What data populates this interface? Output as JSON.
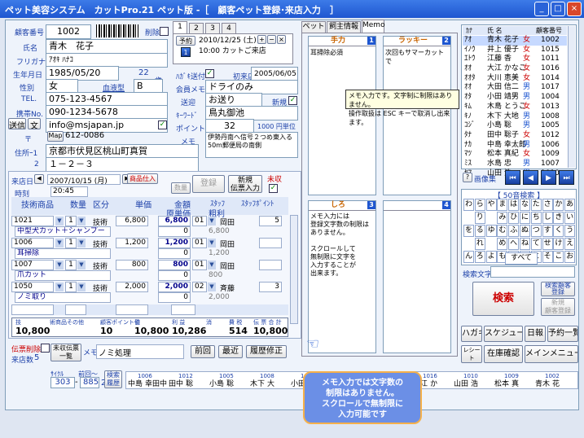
{
  "window": {
    "title": "ペット美容システム　カットPro.21 ペット版 -［　顧客ペット登録･来店入力　］",
    "min": "_",
    "max": "□",
    "close": "×"
  },
  "customer": {
    "no_label": "顧客番号",
    "no": "1002",
    "delete_label": "削除",
    "name_label": "氏名",
    "name": "青木　花子",
    "kana_label": "フリガナ",
    "kana": "ｱｵｷ ﾊﾅｺ",
    "birth_label": "生年月日",
    "birth": "1985/05/20",
    "age": "22",
    "age_unit": "歳",
    "sex_label": "性別",
    "sex": "女",
    "blood_label": "血液型",
    "blood": "B",
    "tel_label": "TEL.",
    "tel": "075-123-4567",
    "mobile_label": "携帯No.",
    "mobile": "090-1234-5678",
    "mail_send": "送信",
    "mail_text": "文",
    "mail": "info@msjapan.jp",
    "zip_label": "〒",
    "map_btn": "Map",
    "zip": "612-0086",
    "addr1_label": "住所ｰ1",
    "addr1": "京都市伏見区桃山町真賀",
    "addr2_label": "2",
    "addr2": "１－２－３"
  },
  "reserve": {
    "tabs": [
      "1",
      "2",
      "3",
      "4"
    ],
    "btn": "予約",
    "num": "1",
    "datetime": "2010/12/25 (土)",
    "text": "10:00 カットご来店"
  },
  "extra": {
    "hagaki_label": "ﾊｶﾞｷ送付",
    "first_label": "初来店",
    "first": "2005/06/05",
    "memo_label": "会員メモ",
    "memo": "ドライのみ",
    "send_label": "送迎",
    "send": "お送り",
    "new_label": "新規",
    "kw_label": "ｷｰﾜｰﾄﾞ",
    "kw": "鳥丸御池",
    "point_label": "ポイント",
    "point": "32",
    "point_unit": "1000 円単位",
    "memo2_label": "メモ",
    "memo2": "伊勢丹南へ信号２つめ東入る\n50m郵便局の南側"
  },
  "visit": {
    "date_label": "来店日",
    "date": "2007/10/15 (月)",
    "time_label": "時刻",
    "time": "20:45",
    "product_btn": "商品仕入",
    "reg_btn": "登録",
    "new_btn": "新規\n伝票入力",
    "unpaid_label": "未収",
    "cnt_label": "数量",
    "headers": [
      "技術商品",
      "数量",
      "区分",
      "単価",
      "金額",
      "ｽﾀｯﾌ",
      "ｽﾀｯﾌﾎﾟｲﾝﾄ"
    ],
    "headers2": [
      "原単価",
      "粗利"
    ],
    "rows": [
      {
        "code": "1021",
        "qty": "1",
        "kind": "技術",
        "price": "6,800",
        "amount": "6,800",
        "staff": "01",
        "staff_name": "岡田",
        "point": "5",
        "name": "中型犬カット＋シャンプー",
        "cost": "0",
        "profit": "6,800"
      },
      {
        "code": "1006",
        "qty": "1",
        "kind": "技術",
        "price": "1,200",
        "amount": "1,200",
        "staff": "01",
        "staff_name": "岡田",
        "point": "",
        "name": "耳掃除",
        "cost": "0",
        "profit": "1,200"
      },
      {
        "code": "1007",
        "qty": "1",
        "kind": "技術",
        "price": "800",
        "amount": "800",
        "staff": "01",
        "staff_name": "岡田",
        "point": "",
        "name": "爪カット",
        "cost": "0",
        "profit": "800"
      },
      {
        "code": "1050",
        "qty": "1",
        "kind": "技術",
        "price": "2,000",
        "amount": "2,000",
        "staff": "02",
        "staff_name": "斉藤",
        "point": "3",
        "name": "ノミ取り",
        "cost": "0",
        "profit": "2,000"
      }
    ],
    "totals_labels": [
      "技",
      "術商品その他",
      "顧客ポイント値",
      "引",
      "利 益",
      "消",
      "費 税",
      "伝 票 合 計"
    ],
    "totals": [
      "10,800",
      "",
      "10",
      "10,800",
      "10,286",
      "",
      "514",
      "10,800"
    ],
    "delete_label": "伝票削除",
    "count_label": "来店数",
    "count": "5",
    "unpaid_btn": "未収伝票\n一覧",
    "memo_label": "メモ",
    "memo": "ノミ処理",
    "prev_btn": "前回",
    "recent_btn": "最近",
    "history_btn": "履歴修正"
  },
  "memo_tabs": [
    "ペット",
    "飼主情報",
    "Memo"
  ],
  "memos": [
    {
      "title": "手力",
      "num": "1",
      "text": "耳掃除必須"
    },
    {
      "title": "ラッキー",
      "num": "2",
      "text": "次回もサマーカットで"
    },
    {
      "title": "しろ",
      "num": "3",
      "text": "メモ入力には\n登録文字数の制限は\nありません。\n\nスクロールして\n無制限に文字を\n入力することが\n出来ます。"
    },
    {
      "title": "",
      "num": "4",
      "text": ""
    }
  ],
  "tooltip": "メモ入力です。文字制に制限はありません。\n操作取扱は ESC キーで取消し出来ます。",
  "list": {
    "headers": [
      "ｶﾅ",
      "氏 名",
      "",
      "顧客番号"
    ],
    "rows": [
      [
        "ｱｵ",
        "青木 花子",
        "女",
        "1002"
      ],
      [
        "ｲﾉｳ",
        "井上 優子",
        "女",
        "1015"
      ],
      [
        "ｴﾄｳ",
        "江藤 香",
        "女",
        "1011"
      ],
      [
        "ｵｵ",
        "大江 かなこ",
        "女",
        "1016"
      ],
      [
        "ｵｵﾀ",
        "大川 恵美",
        "女",
        "1014"
      ],
      [
        "ｵｵ",
        "大田 信二",
        "男",
        "1017"
      ],
      [
        "ｵﾀ",
        "小田 靖男",
        "男",
        "1004"
      ],
      [
        "ｷﾑ",
        "木島 とうこ",
        "女",
        "1013"
      ],
      [
        "ｷﾉ",
        "木下 大地",
        "男",
        "1008"
      ],
      [
        "ｺｼﾞ",
        "小島 聡",
        "男",
        "1005"
      ],
      [
        "ﾀﾅ",
        "田中 聡子",
        "女",
        "1012"
      ],
      [
        "ﾅｶ",
        "中島 幸太郎",
        "男",
        "1006"
      ],
      [
        "ﾏﾂ",
        "松本 真紀",
        "女",
        "1009"
      ],
      [
        "ﾐｽ",
        "水島 忠",
        "男",
        "1007"
      ],
      [
        "ﾔﾏ",
        "山田 浩一",
        "男",
        "1010"
      ]
    ],
    "image_btn": "画像集",
    "nav": [
      "⏮",
      "◀",
      "▶",
      "⏭"
    ]
  },
  "search": {
    "title": "【 50音検索 】",
    "kana": [
      "わ",
      "ら",
      "や",
      "ま",
      "は",
      "な",
      "た",
      "さ",
      "か",
      "あ",
      "",
      "り",
      "",
      "み",
      "ひ",
      "に",
      "ち",
      "し",
      "き",
      "い",
      "を",
      "る",
      "ゆ",
      "む",
      "ふ",
      "ぬ",
      "つ",
      "す",
      "く",
      "う",
      "",
      "れ",
      "",
      "め",
      "へ",
      "ね",
      "て",
      "せ",
      "け",
      "え",
      "ん",
      "ろ",
      "よ",
      "も",
      "ほ",
      "の",
      "と",
      "そ",
      "こ",
      "お"
    ],
    "all": "すべて",
    "text_label": "検索文字",
    "search_btn": "検索",
    "history_btn": "検索顧客\n登録",
    "new_btn": "新規\n顧客登録"
  },
  "bottom_btns": [
    "ハガキ",
    "スケジュール",
    "日報",
    "予約一覧",
    "レシート\n領収書",
    "在庫確認",
    "メインメニュー"
  ],
  "strip": {
    "cycle_label": "ｻｲｸﾙ",
    "prev_label": "前回〜",
    "a": "303",
    "b": "885",
    "c": "2",
    "hist_btn": "検索\n履歴",
    "items": [
      [
        "1006",
        "中島",
        "幸田中"
      ],
      [
        "1012",
        "田中",
        "聡"
      ],
      [
        "1005",
        "小島",
        "聡"
      ],
      [
        "1008",
        "木下",
        "大"
      ],
      [
        "1004",
        "小田",
        "靖"
      ],
      [
        "1017",
        "大田",
        "信"
      ],
      [
        "1014",
        "大川",
        "恵"
      ],
      [
        "1016",
        "大江",
        "か"
      ],
      [
        "1010",
        "山田",
        "浩"
      ],
      [
        "1009",
        "松本",
        "真"
      ],
      [
        "1002",
        "青木",
        "花"
      ]
    ]
  },
  "callout": "メモ入力では文字数の\n制限はありません。\nスクロールで無制限に\n入力可能です"
}
